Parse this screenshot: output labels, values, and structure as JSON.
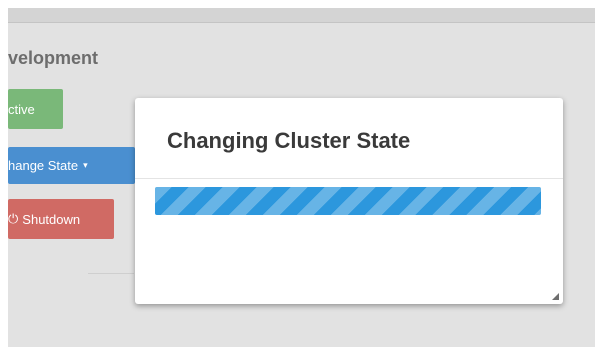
{
  "section": {
    "title": "velopment"
  },
  "buttons": {
    "active_label": "ctive",
    "change_state_label": "hange State",
    "change_state_caret": "▾",
    "shutdown_icon": "power-icon",
    "shutdown_label": "Shutdown"
  },
  "modal": {
    "title": "Changing Cluster State",
    "progress": 1.0
  },
  "colors": {
    "active": "#7ab879",
    "change_state": "#4a8fd0",
    "shutdown": "#d06a64",
    "progress": "#2c97dd"
  }
}
